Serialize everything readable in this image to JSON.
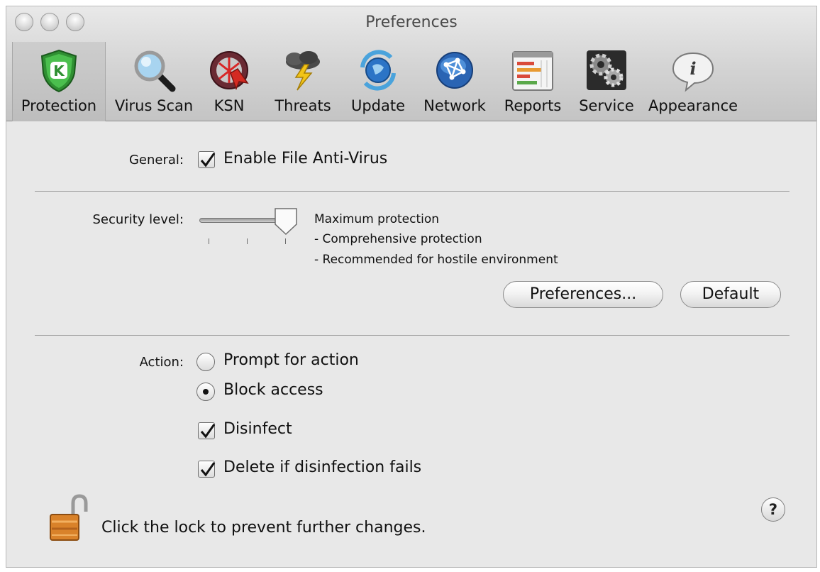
{
  "window": {
    "title": "Preferences"
  },
  "toolbar": {
    "items": [
      {
        "label": "Protection",
        "icon": "protection-shield-icon",
        "selected": true
      },
      {
        "label": "Virus Scan",
        "icon": "magnifier-icon"
      },
      {
        "label": "KSN",
        "icon": "ksn-icon"
      },
      {
        "label": "Threats",
        "icon": "storm-cloud-icon"
      },
      {
        "label": "Update",
        "icon": "update-globe-icon"
      },
      {
        "label": "Network",
        "icon": "network-globe-icon"
      },
      {
        "label": "Reports",
        "icon": "reports-chart-icon"
      },
      {
        "label": "Service",
        "icon": "gears-icon"
      },
      {
        "label": "Appearance",
        "icon": "info-bubble-icon"
      }
    ]
  },
  "general": {
    "label": "General:",
    "enable_label": "Enable File Anti-Virus",
    "enable_checked": true
  },
  "security": {
    "label": "Security level:",
    "level_title": "Maximum protection",
    "detail_1": "- Comprehensive protection",
    "detail_2": "- Recommended for hostile environment",
    "slider_level": 3,
    "slider_levels": 3,
    "preferences_button": "Preferences...",
    "default_button": "Default"
  },
  "action": {
    "label": "Action:",
    "prompt_label": "Prompt for action",
    "block_label": "Block access",
    "selected": "block",
    "disinfect_label": "Disinfect",
    "disinfect_checked": true,
    "delete_label": "Delete if disinfection fails",
    "delete_checked": true
  },
  "lock": {
    "text": "Click the lock to prevent further changes.",
    "state": "unlocked"
  },
  "help": {
    "label": "?"
  }
}
